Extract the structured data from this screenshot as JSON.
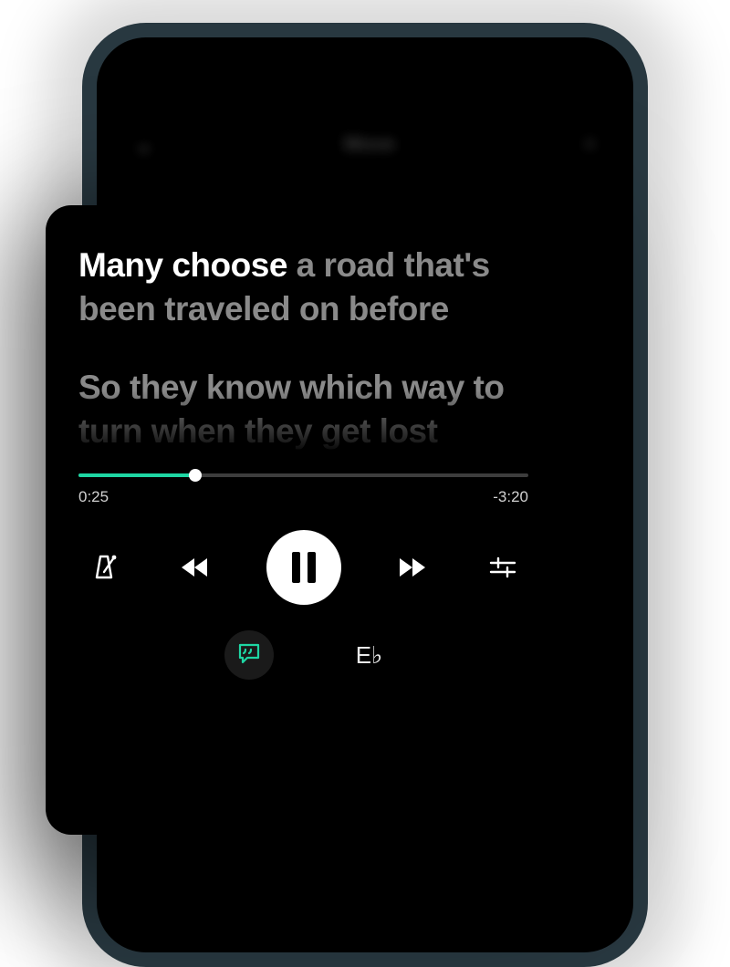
{
  "phone": {
    "title": "Move"
  },
  "lyrics": {
    "line1_active": "Many choose",
    "line1_rest": " a road that's been traveled on before",
    "line2": "So they know which way to turn when they get lost"
  },
  "progress": {
    "elapsed": "0:25",
    "remaining": "-3:20",
    "percent": 26
  },
  "key": "E♭",
  "accent": "#1ed6a3"
}
